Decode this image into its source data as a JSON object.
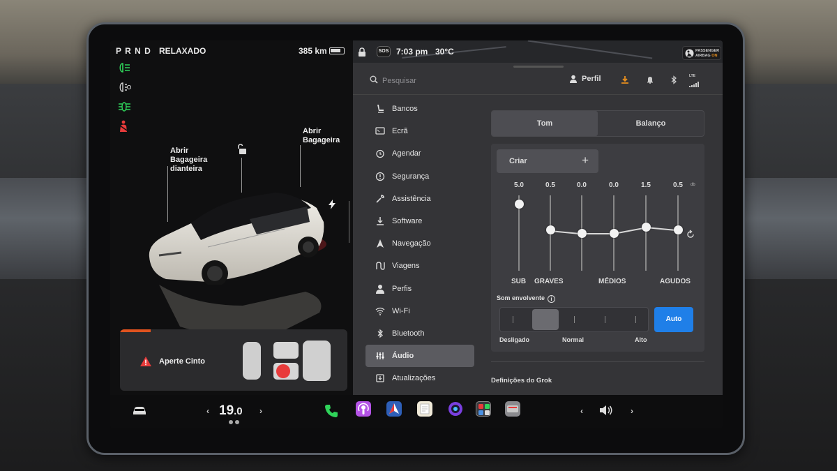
{
  "status": {
    "gear": "P R N D",
    "drive_mode": "RELAXADO",
    "range": "385 km",
    "time": "7:03 pm",
    "outside_temp": "30°C",
    "sos": "SOS",
    "passenger_airbag_line1": "PASSENGER",
    "passenger_airbag_line2": "AIRBAG",
    "passenger_airbag_state": "ON"
  },
  "car": {
    "frunk_line1": "Abrir",
    "frunk_line2": "Bagageira",
    "frunk_line3": "dianteira",
    "trunk_line1": "Abrir",
    "trunk_line2": "Bagageira",
    "seatbelt_warning": "Aperte Cinto"
  },
  "search": {
    "placeholder": "Pesquisar"
  },
  "header": {
    "profile_label": "Perfil",
    "lte": "LTE"
  },
  "menu": {
    "items": [
      {
        "label": "Bancos",
        "icon": "seat-icon"
      },
      {
        "label": "Ecrã",
        "icon": "display-icon"
      },
      {
        "label": "Agendar",
        "icon": "alarm-clock-icon"
      },
      {
        "label": "Segurança",
        "icon": "shield-info-icon"
      },
      {
        "label": "Assistência",
        "icon": "wrench-icon"
      },
      {
        "label": "Software",
        "icon": "download-icon"
      },
      {
        "label": "Navegação",
        "icon": "navigation-arrow-icon"
      },
      {
        "label": "Viagens",
        "icon": "trips-icon"
      },
      {
        "label": "Perfis",
        "icon": "person-icon"
      },
      {
        "label": "Wi-Fi",
        "icon": "wifi-icon"
      },
      {
        "label": "Bluetooth",
        "icon": "bluetooth-icon"
      },
      {
        "label": "Áudio",
        "icon": "equalizer-icon"
      },
      {
        "label": "Atualizações",
        "icon": "updates-icon"
      }
    ],
    "active": "Áudio"
  },
  "audio": {
    "tabs": [
      {
        "label": "Tom",
        "selected": true
      },
      {
        "label": "Balanço",
        "selected": false
      }
    ],
    "create_label": "Criar",
    "create_plus": "+",
    "db_unit": "db",
    "eq": [
      {
        "value": "5.0",
        "level": 0.88
      },
      {
        "value": "0.5",
        "level": 0.54
      },
      {
        "value": "0.0",
        "level": 0.5
      },
      {
        "value": "0.0",
        "level": 0.5
      },
      {
        "value": "1.5",
        "level": 0.58
      },
      {
        "value": "0.5",
        "level": 0.54
      }
    ],
    "eq_labels": {
      "sub": "SUB",
      "graves": "GRAVES",
      "medios": "MÉDIOS",
      "agudos": "AGUDOS"
    },
    "surround_label": "Som envolvente",
    "surround_info": "i",
    "surround_level": 0.25,
    "surround_options": {
      "off": "Desligado",
      "normal": "Normal",
      "high": "Alto"
    },
    "auto_label": "Auto",
    "grok_heading": "Definições do Grok"
  },
  "dock": {
    "cabin_temp_whole": "19",
    "cabin_temp_decimal": ".0",
    "prev": "‹",
    "next": "›"
  },
  "colors": {
    "accent_blue": "#1f7fe8",
    "indicator_green": "#2fd35a",
    "warning_red": "#e83b3b",
    "orange": "#e9901e"
  }
}
